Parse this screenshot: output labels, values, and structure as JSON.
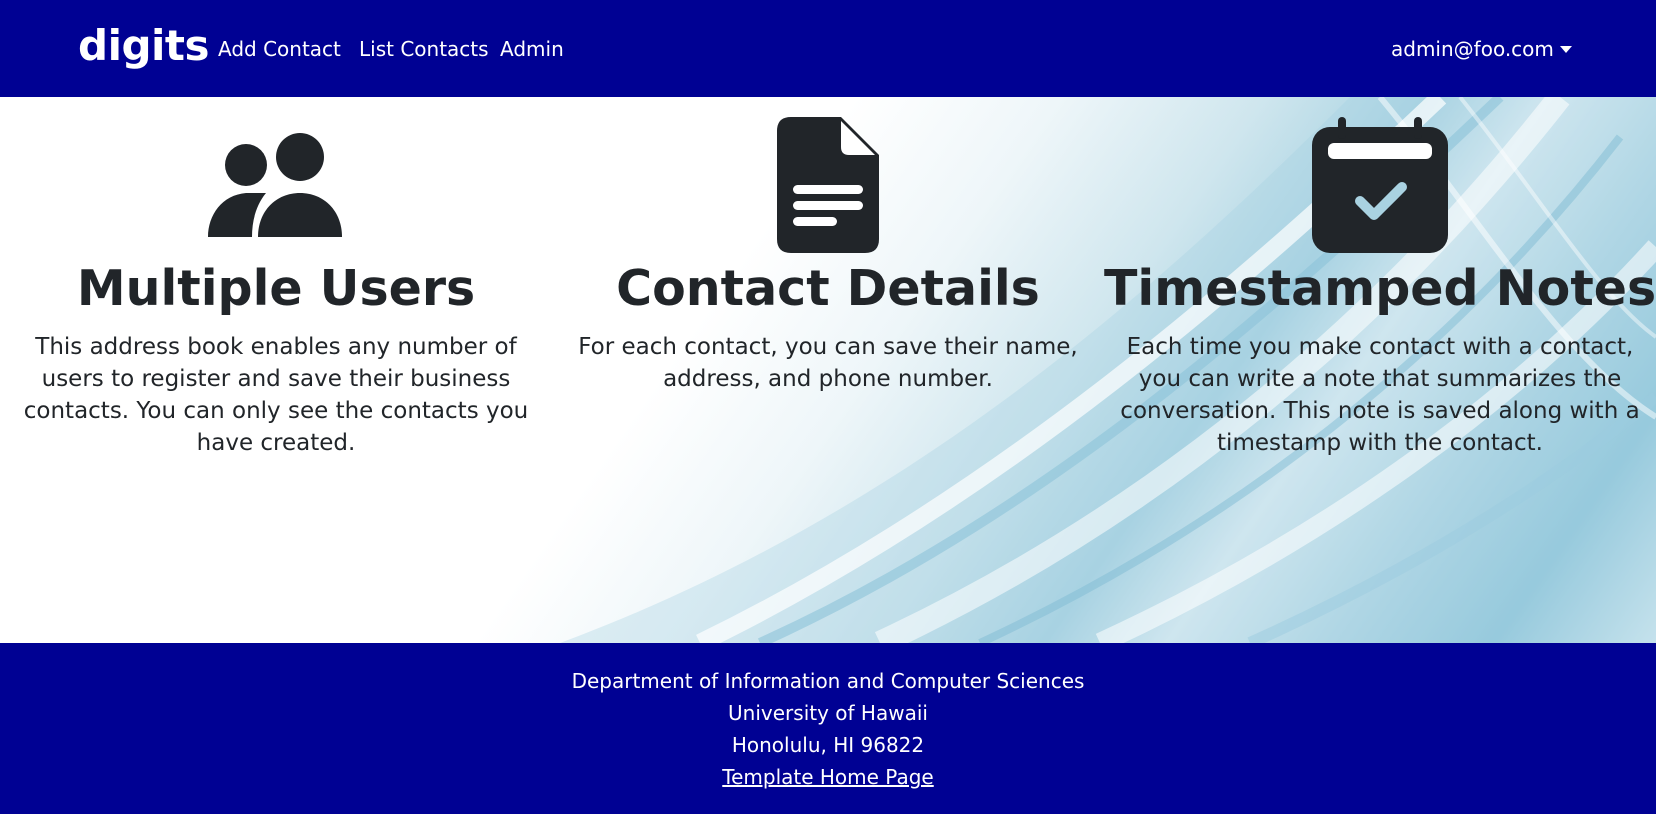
{
  "navbar": {
    "brand": "digits",
    "links": {
      "add_contact": "Add Contact",
      "list_contacts": "List Contacts",
      "admin": "Admin"
    },
    "user": "admin@foo.com",
    "background": "#000193"
  },
  "features": [
    {
      "icon": "users-icon",
      "title": "Multiple Users",
      "text": "This address book enables any number of users to register and save their business contacts. You can only see the contacts you have created."
    },
    {
      "icon": "file-text-icon",
      "title": "Contact Details",
      "text": "For each contact, you can save their name, address, and phone number."
    },
    {
      "icon": "calendar-check-icon",
      "title": "Timestamped Notes",
      "text": "Each time you make contact with a contact, you can write a note that summarizes the conversation. This note is saved along with a timestamp with the contact."
    }
  ],
  "footer": {
    "line1": "Department of Information and Computer Sciences",
    "line2": "University of Hawaii",
    "line3": "Honolulu, HI 96822",
    "link": "Template Home Page"
  },
  "colors": {
    "navy": "#000193",
    "text": "#212529",
    "icon": "#212529"
  }
}
